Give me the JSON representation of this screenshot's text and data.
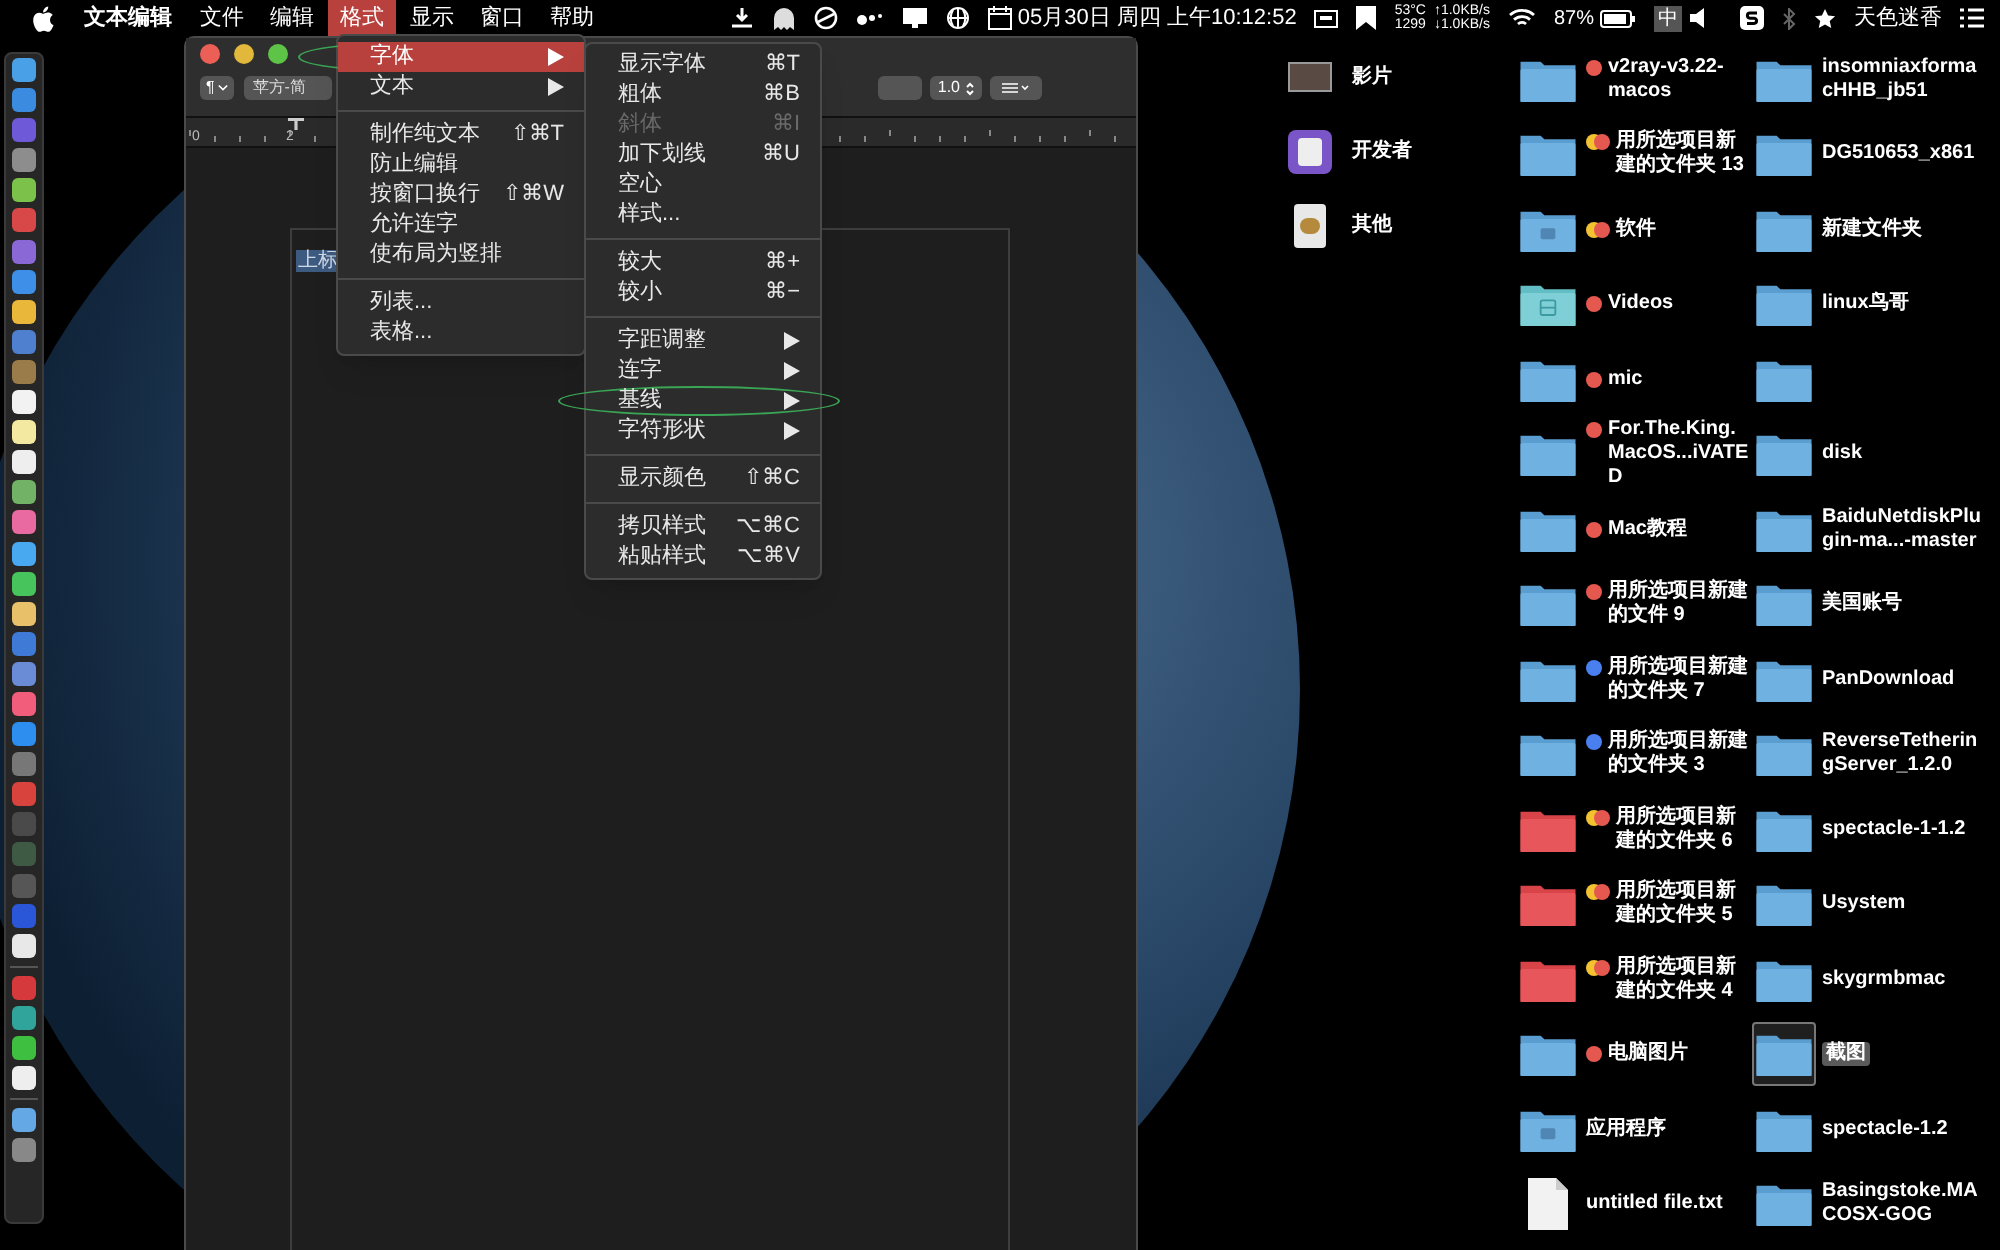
{
  "menu_bar": {
    "app_name": "文本编辑",
    "menus": [
      {
        "label": "文件",
        "selected": false
      },
      {
        "label": "编辑",
        "selected": false
      },
      {
        "label": "格式",
        "selected": true
      },
      {
        "label": "显示",
        "selected": false
      },
      {
        "label": "窗口",
        "selected": false
      },
      {
        "label": "帮助",
        "selected": false
      }
    ],
    "clock": "05月30日 周四 上午10:12:52",
    "temperature": "53°C",
    "fan_speed": "1299",
    "upload_speed": "↑1.0KB/s",
    "download_speed": "↓1.0KB/s",
    "battery_percent": "87%",
    "input_method": "中",
    "user_name": "天色迷香"
  },
  "window": {
    "toolbar": {
      "paragraph_style": "¶",
      "font": "苹方-简",
      "line_spacing": "1.0"
    },
    "ruler_labels": [
      "0",
      "2"
    ],
    "selected_text": "上标"
  },
  "format_menu": {
    "items": [
      {
        "kind": "item",
        "label": "字体",
        "submenu": true,
        "selected": true,
        "circled": true
      },
      {
        "kind": "item",
        "label": "文本",
        "submenu": true,
        "selected": false,
        "circled": false
      },
      {
        "kind": "separator"
      },
      {
        "kind": "item",
        "label": "制作纯文本",
        "shortcut": "⇧⌘T",
        "submenu": false,
        "selected": false,
        "circled": false
      },
      {
        "kind": "item",
        "label": "防止编辑",
        "submenu": false,
        "selected": false,
        "circled": false
      },
      {
        "kind": "item",
        "label": "按窗口换行",
        "shortcut": "⇧⌘W",
        "submenu": false,
        "selected": false,
        "circled": false
      },
      {
        "kind": "item",
        "label": "允许连字",
        "submenu": false,
        "selected": false,
        "circled": false
      },
      {
        "kind": "item",
        "label": "使布局为竖排",
        "submenu": false,
        "selected": false,
        "circled": false
      },
      {
        "kind": "separator"
      },
      {
        "kind": "item",
        "label": "列表...",
        "submenu": false,
        "selected": false,
        "circled": false
      },
      {
        "kind": "item",
        "label": "表格...",
        "submenu": false,
        "selected": false,
        "circled": false
      }
    ]
  },
  "font_submenu": {
    "items": [
      {
        "kind": "item",
        "label": "显示字体",
        "shortcut": "⌘T",
        "submenu": false,
        "disabled": false,
        "circled": false
      },
      {
        "kind": "item",
        "label": "粗体",
        "shortcut": "⌘B",
        "submenu": false,
        "disabled": false,
        "circled": false
      },
      {
        "kind": "item",
        "label": "斜体",
        "shortcut": "⌘I",
        "submenu": false,
        "disabled": true,
        "circled": false
      },
      {
        "kind": "item",
        "label": "加下划线",
        "shortcut": "⌘U",
        "submenu": false,
        "disabled": false,
        "circled": false
      },
      {
        "kind": "item",
        "label": "空心",
        "submenu": false,
        "disabled": false,
        "circled": false
      },
      {
        "kind": "item",
        "label": "样式...",
        "submenu": false,
        "disabled": false,
        "circled": false
      },
      {
        "kind": "separator"
      },
      {
        "kind": "item",
        "label": "较大",
        "shortcut": "⌘+",
        "submenu": false,
        "disabled": false,
        "circled": false
      },
      {
        "kind": "item",
        "label": "较小",
        "shortcut": "⌘−",
        "submenu": false,
        "disabled": false,
        "circled": false
      },
      {
        "kind": "separator"
      },
      {
        "kind": "item",
        "label": "字距调整",
        "submenu": true,
        "disabled": false,
        "circled": false
      },
      {
        "kind": "item",
        "label": "连字",
        "submenu": true,
        "disabled": false,
        "circled": false
      },
      {
        "kind": "item",
        "label": "基线",
        "submenu": true,
        "disabled": false,
        "circled": true
      },
      {
        "kind": "item",
        "label": "字符形状",
        "submenu": true,
        "disabled": false,
        "circled": false
      },
      {
        "kind": "separator"
      },
      {
        "kind": "item",
        "label": "显示颜色",
        "shortcut": "⇧⌘C",
        "submenu": false,
        "disabled": false,
        "circled": false
      },
      {
        "kind": "separator"
      },
      {
        "kind": "item",
        "label": "拷贝样式",
        "shortcut": "⌥⌘C",
        "submenu": false,
        "disabled": false,
        "circled": false
      },
      {
        "kind": "item",
        "label": "粘贴样式",
        "shortcut": "⌥⌘V",
        "submenu": false,
        "disabled": false,
        "circled": false
      }
    ]
  },
  "desktop": {
    "shortcuts": [
      {
        "label": "影片",
        "kind": "thumbnail"
      },
      {
        "label": "开发者",
        "kind": "app"
      },
      {
        "label": "其他",
        "kind": "package"
      }
    ],
    "column_2": [
      {
        "label": "v2ray-v3.22-\nmacos",
        "kind": "folder",
        "tags": [
          {
            "color": "#e5584f"
          }
        ],
        "selected": false
      },
      {
        "label": "用所选项目新建的文件夹 13",
        "kind": "folder",
        "tags": [
          {
            "color": "#f2c230"
          },
          {
            "color": "#e5584f"
          }
        ],
        "selected": false
      },
      {
        "label": "软件",
        "kind": "apps-folder",
        "tags": [
          {
            "color": "#f2c230"
          },
          {
            "color": "#e5584f"
          }
        ],
        "selected": false
      },
      {
        "label": "Videos",
        "kind": "media-folder",
        "tags": [
          {
            "color": "#e5584f"
          }
        ],
        "selected": false
      },
      {
        "label": "mic",
        "kind": "folder",
        "tags": [
          {
            "color": "#e5584f"
          }
        ],
        "selected": false
      },
      {
        "label": "For.The.King.\nMacOS...iVATED",
        "kind": "folder",
        "tags": [
          {
            "color": "#e5584f"
          }
        ],
        "selected": false
      },
      {
        "label": "Mac教程",
        "kind": "folder",
        "tags": [
          {
            "color": "#e5584f"
          }
        ],
        "selected": false
      },
      {
        "label": "用所选项目新建的文件 9",
        "kind": "folder",
        "tags": [
          {
            "color": "#e5584f"
          }
        ],
        "selected": false
      },
      {
        "label": "用所选项目新建的文件夹 7",
        "kind": "folder",
        "tags": [
          {
            "color": "#4a7ff0"
          }
        ],
        "selected": false
      },
      {
        "label": "用所选项目新建的文件夹 3",
        "kind": "folder",
        "tags": [
          {
            "color": "#4a7ff0"
          }
        ],
        "selected": false
      },
      {
        "label": "用所选项目新建的文件夹 6",
        "kind": "red-folder",
        "tags": [
          {
            "color": "#f2c230"
          },
          {
            "color": "#e5584f"
          }
        ],
        "selected": false
      },
      {
        "label": "用所选项目新建的文件夹 5",
        "kind": "red-folder",
        "tags": [
          {
            "color": "#f2c230"
          },
          {
            "color": "#e5584f"
          }
        ],
        "selected": false
      },
      {
        "label": "用所选项目新建的文件夹 4",
        "kind": "red-folder",
        "tags": [
          {
            "color": "#f2c230"
          },
          {
            "color": "#e5584f"
          }
        ],
        "selected": false
      },
      {
        "label": "电脑图片",
        "kind": "folder",
        "tags": [
          {
            "color": "#e5584f"
          }
        ],
        "selected": false
      },
      {
        "label": "应用程序",
        "kind": "apps-folder",
        "selected": false
      },
      {
        "label": "untitled file.txt",
        "kind": "file",
        "selected": false
      }
    ],
    "column_3": [
      {
        "label": "insomniaxforma\ncHHB_jb51",
        "selected": false
      },
      {
        "label": "DG510653_x861",
        "selected": false
      },
      {
        "label": "新建文件夹",
        "selected": false
      },
      {
        "label": "linux鸟哥",
        "selected": false
      },
      {
        "selected": false
      },
      {
        "label": "disk",
        "selected": false
      },
      {
        "label": "BaiduNetdiskPlu\ngin-ma...-master",
        "selected": false
      },
      {
        "label": "美国账号",
        "selected": false
      },
      {
        "label": "PanDownload",
        "selected": false
      },
      {
        "label": "ReverseTetherin\ngServer_1.2.0",
        "selected": false
      },
      {
        "label": "spectacle-1-1.2",
        "selected": false
      },
      {
        "label": "Usystem",
        "selected": false
      },
      {
        "label": "skygrmbmac",
        "selected": false
      },
      {
        "label": "截图",
        "selected": true
      },
      {
        "label": "spectacle-1.2",
        "selected": false
      },
      {
        "label": "Basingstoke.MA\nCOSX-GOG",
        "selected": false
      }
    ]
  }
}
